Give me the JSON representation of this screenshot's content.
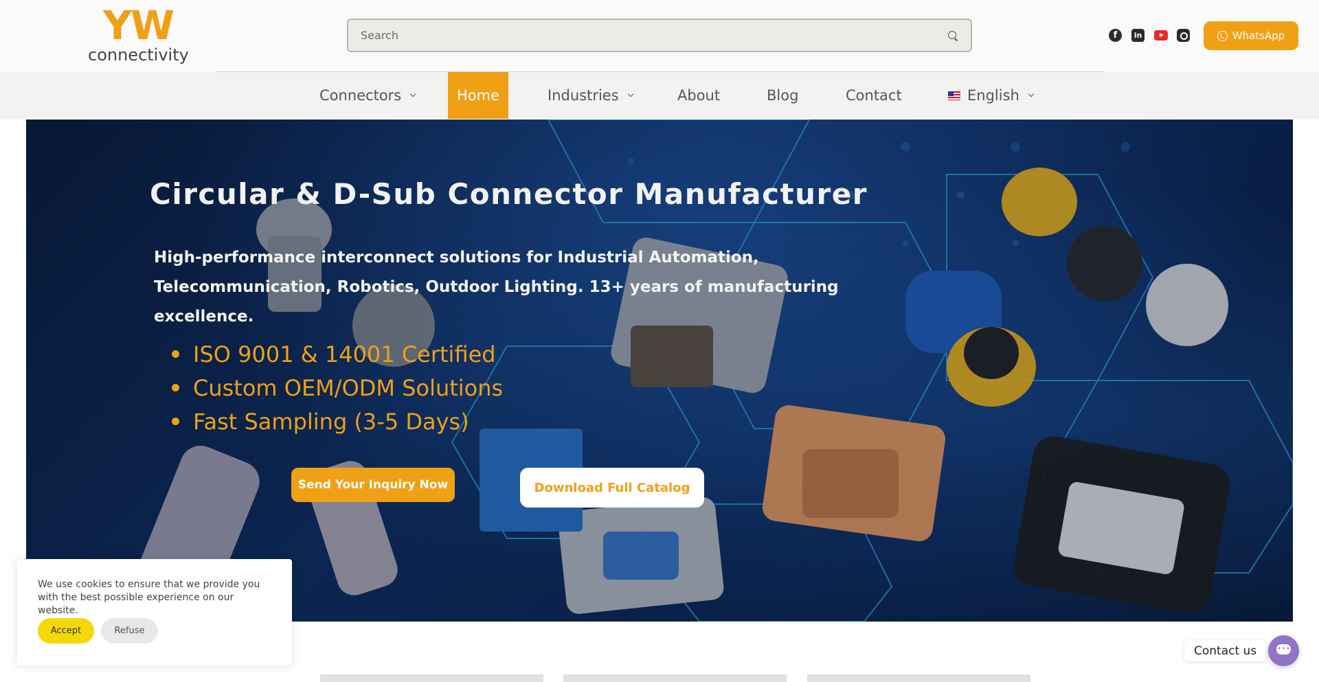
{
  "header": {
    "logo": {
      "mark": "YW",
      "wordmark": "connectivity"
    },
    "search": {
      "placeholder": "Search",
      "value": ""
    },
    "social": [
      {
        "icon": "facebook-icon",
        "glyph": "f"
      },
      {
        "icon": "linkedin-icon",
        "glyph": "in"
      },
      {
        "icon": "youtube-icon"
      },
      {
        "icon": "instagram-icon"
      }
    ],
    "whatsapp_label": "WhatsApp"
  },
  "nav": {
    "items": [
      {
        "label": "Connectors",
        "has_dropdown": true,
        "active": false
      },
      {
        "label": "Home",
        "has_dropdown": false,
        "active": true
      },
      {
        "label": "Industries",
        "has_dropdown": true,
        "active": false
      },
      {
        "label": "About",
        "has_dropdown": false,
        "active": false
      },
      {
        "label": "Blog",
        "has_dropdown": false,
        "active": false
      },
      {
        "label": "Contact",
        "has_dropdown": false,
        "active": false
      },
      {
        "label": "English",
        "has_dropdown": true,
        "active": false,
        "icon": "us-flag-icon"
      }
    ]
  },
  "hero": {
    "title": "Circular & D-Sub Connector Manufacturer",
    "subtitle": "High-performance interconnect solutions for Industrial Automation, Telecommunication, Robotics, Outdoor Lighting. 13+ years of manufacturing excellence.",
    "bullets": [
      "ISO 9001 & 14001 Certified",
      "Custom OEM/ODM Solutions",
      "Fast Sampling (3-5 Days)"
    ],
    "primary_button": "Send Your Inquiry Now",
    "secondary_button": "Download Full Catalog"
  },
  "cookie": {
    "text": "We use cookies to ensure that we provide you with the best possible experience on our website.",
    "accept_label": "Accept",
    "refuse_label": "Refuse"
  },
  "contact_widget": {
    "label": "Contact us"
  },
  "colors": {
    "accent": "#f0a015",
    "hero_bg": "#0e2c5c",
    "cookie_accept": "#f5d80a",
    "contact_fab": "#8f74c7"
  }
}
